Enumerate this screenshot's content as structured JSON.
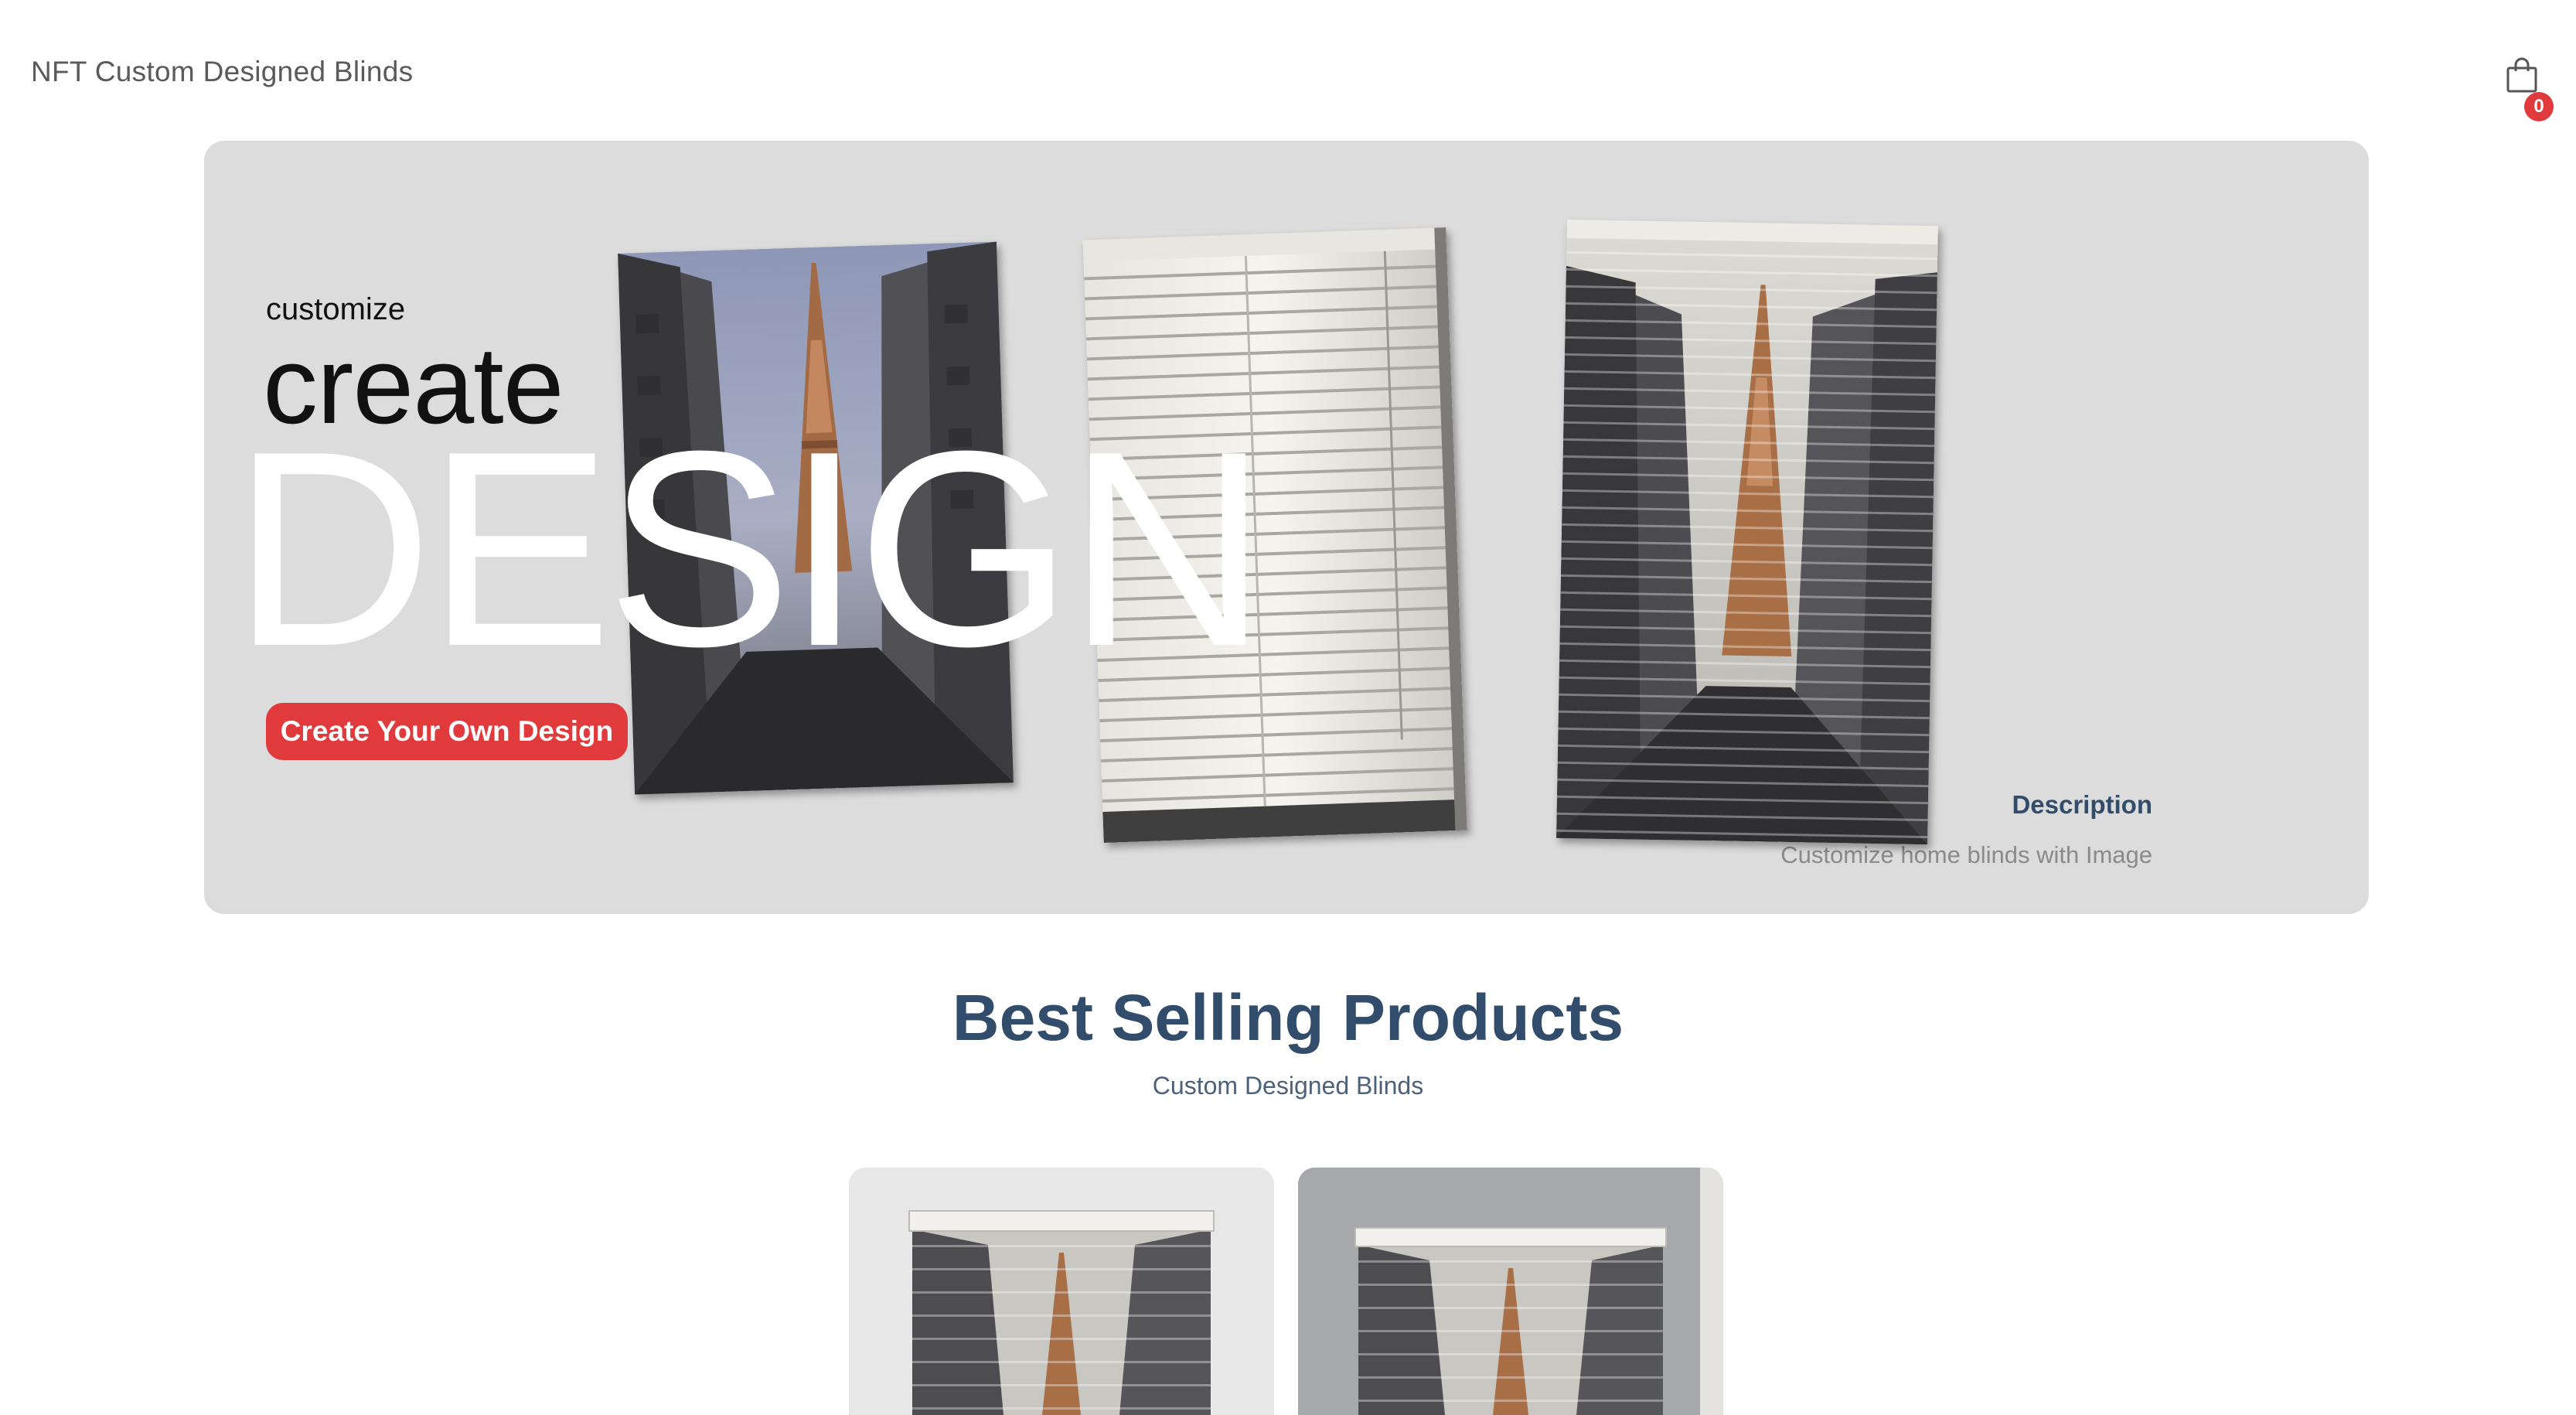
{
  "header": {
    "logo_text": "NFT Custom Designed Blinds",
    "cart_icon": "shopping-bag-icon",
    "cart_count": "0"
  },
  "hero": {
    "small_text": "customize",
    "medium_text": "create",
    "large_text": "DESIGN",
    "cta_label": "Create Your Own Design",
    "description_title": "Description",
    "description_text": "Customize home blinds with Image",
    "background_color": "#dcdcdc",
    "accent_color": "#e03a3c"
  },
  "best_selling": {
    "title": "Best Selling Products",
    "subtitle": "Custom Designed Blinds"
  },
  "colors": {
    "heading": "#324d6b",
    "badge": "#e03a3c"
  }
}
